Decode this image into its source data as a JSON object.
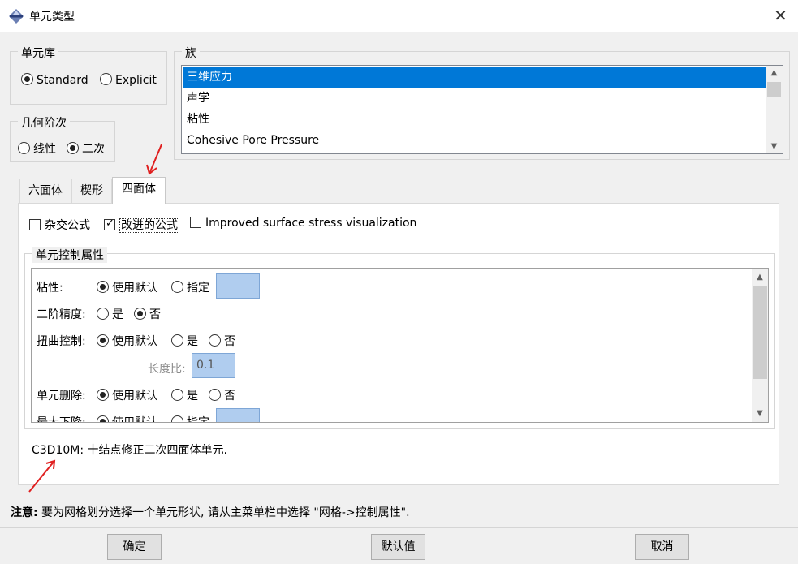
{
  "window": {
    "title": "单元类型",
    "close_glyph": "✕"
  },
  "library": {
    "legend": "单元库",
    "options": [
      "Standard",
      "Explicit"
    ],
    "selected": "Standard"
  },
  "geometric_order": {
    "legend": "几何阶次",
    "options": [
      "线性",
      "二次"
    ],
    "selected": "二次"
  },
  "family": {
    "legend": "族",
    "items": [
      "三维应力",
      "声学",
      "粘性",
      "Cohesive Pore Pressure"
    ],
    "selected_index": 0
  },
  "tabs": [
    "六面体",
    "楔形",
    "四面体"
  ],
  "active_tab": "四面体",
  "formulation": {
    "hybrid_label": "杂交公式",
    "hybrid_checked": false,
    "improved_label": "改进的公式",
    "improved_checked": true,
    "surface_label": "Improved surface stress visualization",
    "surface_checked": false
  },
  "element_controls": {
    "legend": "单元控制属性",
    "viscosity": {
      "label": "粘性:",
      "default_label": "使用默认",
      "specify_label": "指定"
    },
    "second_order_accuracy": {
      "label": "二阶精度:",
      "yes_label": "是",
      "no_label": "否"
    },
    "distortion_control": {
      "label": "扭曲控制:",
      "default_label": "使用默认",
      "yes_label": "是",
      "no_label": "否"
    },
    "length_ratio": {
      "label": "长度比:",
      "value": "0.1"
    },
    "element_deletion": {
      "label": "单元删除:",
      "default_label": "使用默认",
      "yes_label": "是",
      "no_label": "否"
    },
    "max_degradation": {
      "label": "最大下降:",
      "default_label": "使用默认",
      "specify_label": "指定"
    }
  },
  "description": "C3D10M:  十结点修正二次四面体单元.",
  "note": {
    "bold": "注意:",
    "text": " 要为网格划分选择一个单元形状, 请从主菜单栏中选择 \"网格->控制属性\"."
  },
  "buttons": {
    "ok": "确定",
    "defaults": "默认值",
    "cancel": "取消"
  },
  "colors": {
    "selection": "#0078d7",
    "input_fill": "#b0cdef",
    "annotation_arrow": "#e02020"
  },
  "icons": [
    "app-icon",
    "close-icon",
    "scroll-up-icon",
    "scroll-down-icon"
  ]
}
